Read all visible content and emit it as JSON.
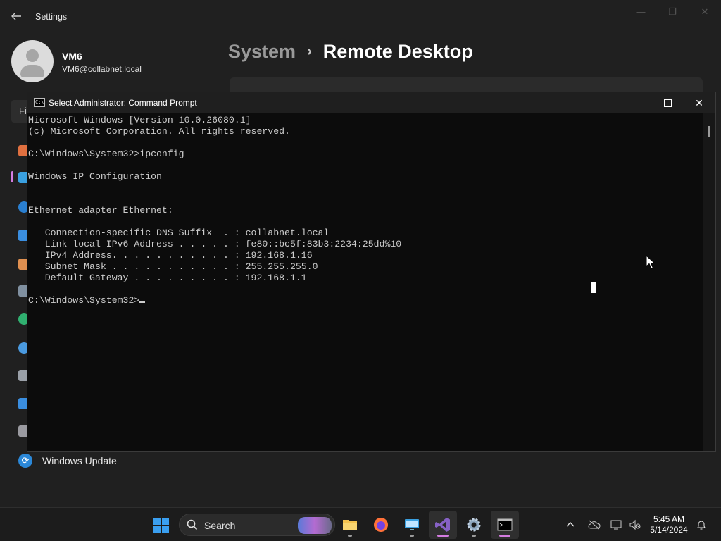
{
  "settings": {
    "title": "Settings",
    "user": {
      "name": "VM6",
      "email": "VM6@collabnet.local"
    },
    "breadcrumb": {
      "parent": "System",
      "separator": "›",
      "current": "Remote Desktop"
    },
    "search_partial": "Fi",
    "nav_partial_label": "Windows Update"
  },
  "cmd": {
    "title": "Select Administrator: Command Prompt",
    "lines": [
      "Microsoft Windows [Version 10.0.26080.1]",
      "(c) Microsoft Corporation. All rights reserved.",
      "",
      "C:\\Windows\\System32>ipconfig",
      "",
      "Windows IP Configuration",
      "",
      "",
      "Ethernet adapter Ethernet:",
      "",
      "   Connection-specific DNS Suffix  . : collabnet.local",
      "   Link-local IPv6 Address . . . . . : fe80::bc5f:83b3:2234:25dd%10",
      "   IPv4 Address. . . . . . . . . . . : 192.168.1.16",
      "   Subnet Mask . . . . . . . . . . . : 255.255.255.0",
      "   Default Gateway . . . . . . . . . : 192.168.1.1",
      ""
    ],
    "prompt": "C:\\Windows\\System32>"
  },
  "taskbar": {
    "search_placeholder": "Search",
    "apps": [
      "start-icon",
      "file-explorer-icon",
      "firefox-icon",
      "remote-desktop-icon",
      "visual-studio-icon",
      "settings-icon",
      "command-prompt-icon"
    ],
    "time": "5:45 AM",
    "date": "5/14/2024"
  },
  "colors": {
    "accent": "#d47ce0",
    "console_bg": "#0c0c0c",
    "console_text": "#cccccc",
    "settings_bg": "#202020"
  }
}
